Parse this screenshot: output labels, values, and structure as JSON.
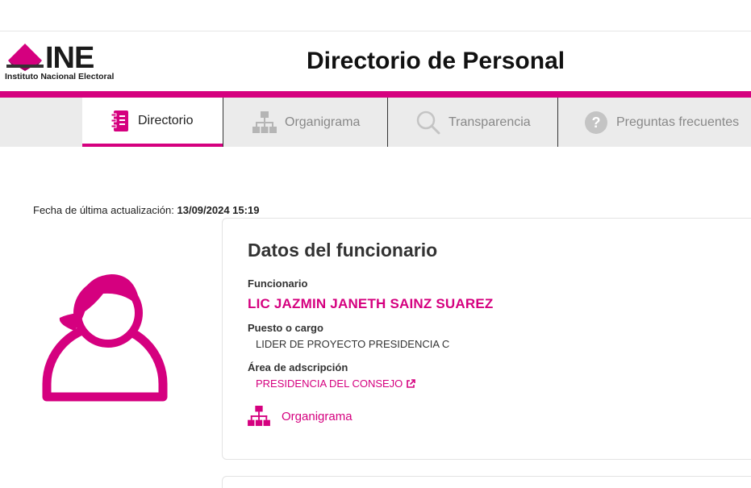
{
  "header": {
    "logo_text": "INE",
    "logo_subtitle": "Instituto Nacional Electoral",
    "title": "Directorio de Personal"
  },
  "tabs": [
    {
      "label": "Directorio",
      "icon": "notebook-icon",
      "active": true
    },
    {
      "label": "Organigrama",
      "icon": "org-chart-icon",
      "active": false
    },
    {
      "label": "Transparencia",
      "icon": "search-icon",
      "active": false
    },
    {
      "label": "Preguntas frecuentes",
      "icon": "question-circle-icon",
      "active": false
    }
  ],
  "updated": {
    "label": "Fecha de última actualización:",
    "value": "13/09/2024 15:19"
  },
  "card": {
    "title": "Datos del funcionario",
    "funcionario_label": "Funcionario",
    "funcionario_name": "LIC JAZMIN JANETH SAINZ SUAREZ",
    "puesto_label": "Puesto o cargo",
    "puesto_value": "LIDER DE PROYECTO PRESIDENCIA C",
    "area_label": "Área de adscripción",
    "area_value": "PRESIDENCIA DEL CONSEJO",
    "organigrama_link": "Organigrama"
  },
  "colors": {
    "accent": "#d5007f",
    "tab_bg": "#ebebeb",
    "inactive_text": "#888888"
  }
}
